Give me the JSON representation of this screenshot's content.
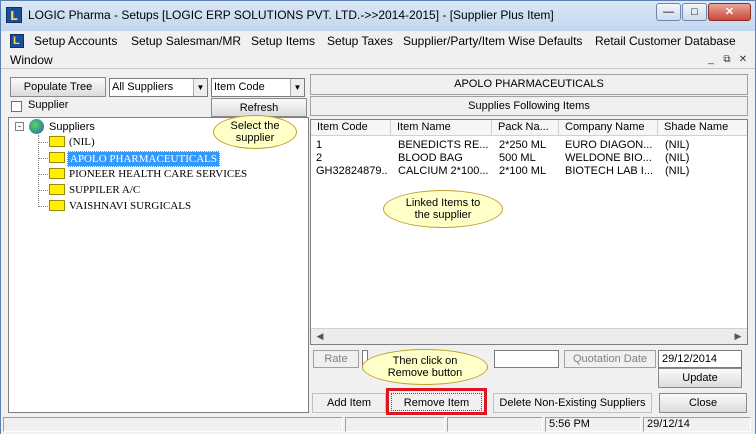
{
  "window": {
    "title": "LOGIC Pharma - Setups  [LOGIC ERP SOLUTIONS PVT. LTD.->>2014-2015] - [Supplier Plus Item]",
    "app_icon": "L"
  },
  "menu": {
    "items": [
      "Setup Accounts",
      "Setup Salesman/MR",
      "Setup Items",
      "Setup Taxes",
      "Supplier/Party/Item Wise Defaults",
      "Retail Customer Database"
    ],
    "window_label": "Window"
  },
  "left": {
    "populate_tree_label": "Populate Tree",
    "supplier_filter": "All Suppliers",
    "sort_field": "Item Code",
    "supplier_checkbox_label": "Supplier",
    "refresh_label": "Refresh",
    "tree": {
      "root": "Suppliers",
      "nodes": [
        "(NIL)",
        "APOLO PHARMACEUTICALS",
        "PIONEER HEALTH CARE SERVICES",
        "SUPPILER A/C",
        "VAISHNAVI SURGICALS"
      ],
      "selected_index": 1
    },
    "callout_select": "Select the supplier"
  },
  "right": {
    "supplier_name": "APOLO PHARMACEUTICALS",
    "subheader": "Supplies Following Items",
    "columns": [
      "Item Code",
      "Item Name",
      "Pack Na...",
      "Company Name",
      "Shade Name"
    ],
    "rows": [
      [
        "1",
        "BENEDICTS RE...",
        "2*250 ML",
        "EURO DIAGON...",
        "(NIL)"
      ],
      [
        "2",
        "BLOOD BAG",
        "500 ML",
        "WELDONE BIO...",
        "(NIL)"
      ],
      [
        "GH32824879...",
        "CALCIUM 2*100...",
        "2*100 ML",
        "BIOTECH LAB I...",
        "(NIL)"
      ]
    ],
    "callout_linked": "Linked Items to the supplier",
    "rate_label": "Rate",
    "quotation_date_label": "Quotation Date",
    "quotation_date": "29/12/2014",
    "update_label": "Update",
    "callout_remove": "Then click on Remove button"
  },
  "bottom": {
    "add_item": "Add Item",
    "remove_item": "Remove Item",
    "delete_nonexisting": "Delete Non-Existing Suppliers",
    "close": "Close"
  },
  "status": {
    "time": "5:56 PM",
    "date": "29/12/14"
  },
  "colors": {
    "selection": "#3399ff",
    "highlight_box": "#e0141e",
    "callout_fill": "#ffffc8",
    "folder": "#ffef00"
  }
}
